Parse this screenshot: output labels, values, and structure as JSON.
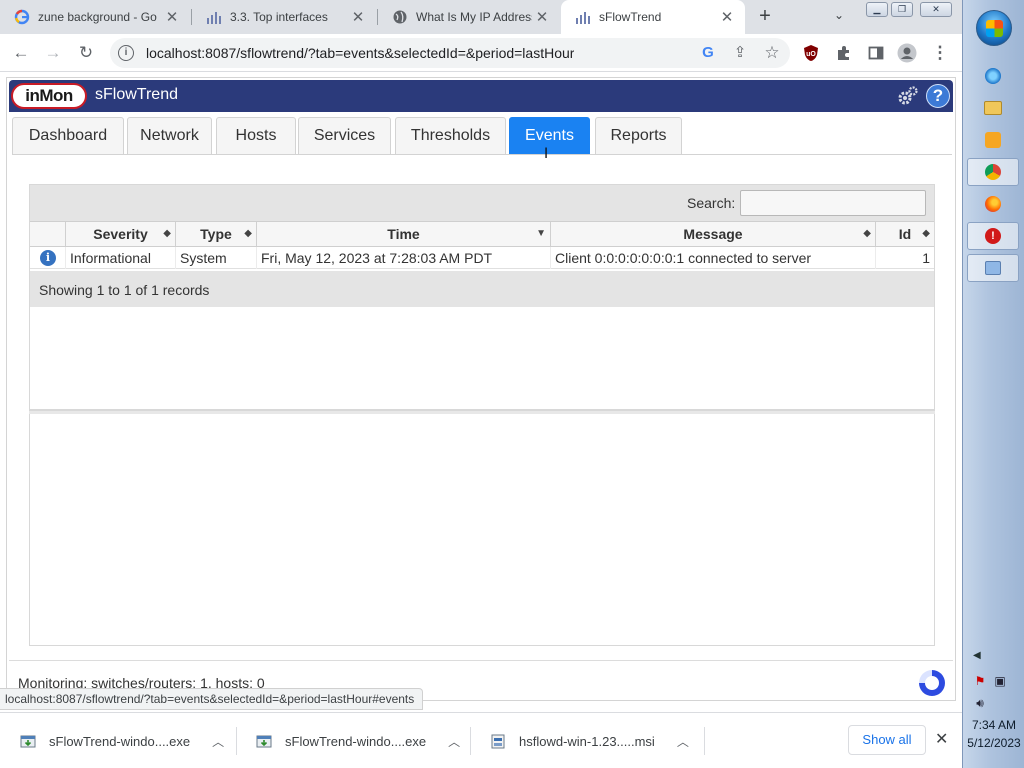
{
  "browser": {
    "tabs": [
      {
        "title": "zune background - Go",
        "icon": "google-icon"
      },
      {
        "title": "3.3. Top interfaces",
        "icon": "chart-icon"
      },
      {
        "title": "What Is My IP Address",
        "icon": "globe-icon"
      },
      {
        "title": "sFlowTrend",
        "icon": "chart-icon"
      }
    ],
    "url": "localhost:8087/sflowtrend/?tab=events&selectedId=&period=lastHour",
    "hover_url": "localhost:8087/sflowtrend/?tab=events&selectedId=&period=lastHour#events"
  },
  "app": {
    "logo_text": "inMon",
    "name": "sFlowTrend",
    "nav_tabs": [
      "Dashboard",
      "Network",
      "Hosts",
      "Services",
      "Thresholds",
      "Events",
      "Reports"
    ],
    "active_tab": "Events"
  },
  "events": {
    "search_label": "Search:",
    "search_value": "",
    "columns": [
      "Severity",
      "Type",
      "Time",
      "Message",
      "Id"
    ],
    "rows": [
      {
        "severity": "Informational",
        "type": "System",
        "time": "Fri, May 12, 2023 at 7:28:03 AM PDT",
        "message": "Client 0:0:0:0:0:0:0:1 connected to server",
        "id": "1"
      }
    ],
    "records_text": "Showing 1 to 1 of 1 records"
  },
  "status": {
    "text": "Monitoring: switches/routers: 1, hosts: 0"
  },
  "downloads": {
    "items": [
      {
        "name": "sFlowTrend-windo....exe"
      },
      {
        "name": "sFlowTrend-windo....exe"
      },
      {
        "name": "hsflowd-win-1.23.....msi"
      }
    ],
    "show_all": "Show all"
  },
  "taskbar": {
    "time": "7:34 AM",
    "date": "5/12/2023"
  },
  "colors": {
    "banner": "#2b3a7b",
    "active_tab": "#1a82f2",
    "link": "#1a73e8"
  }
}
